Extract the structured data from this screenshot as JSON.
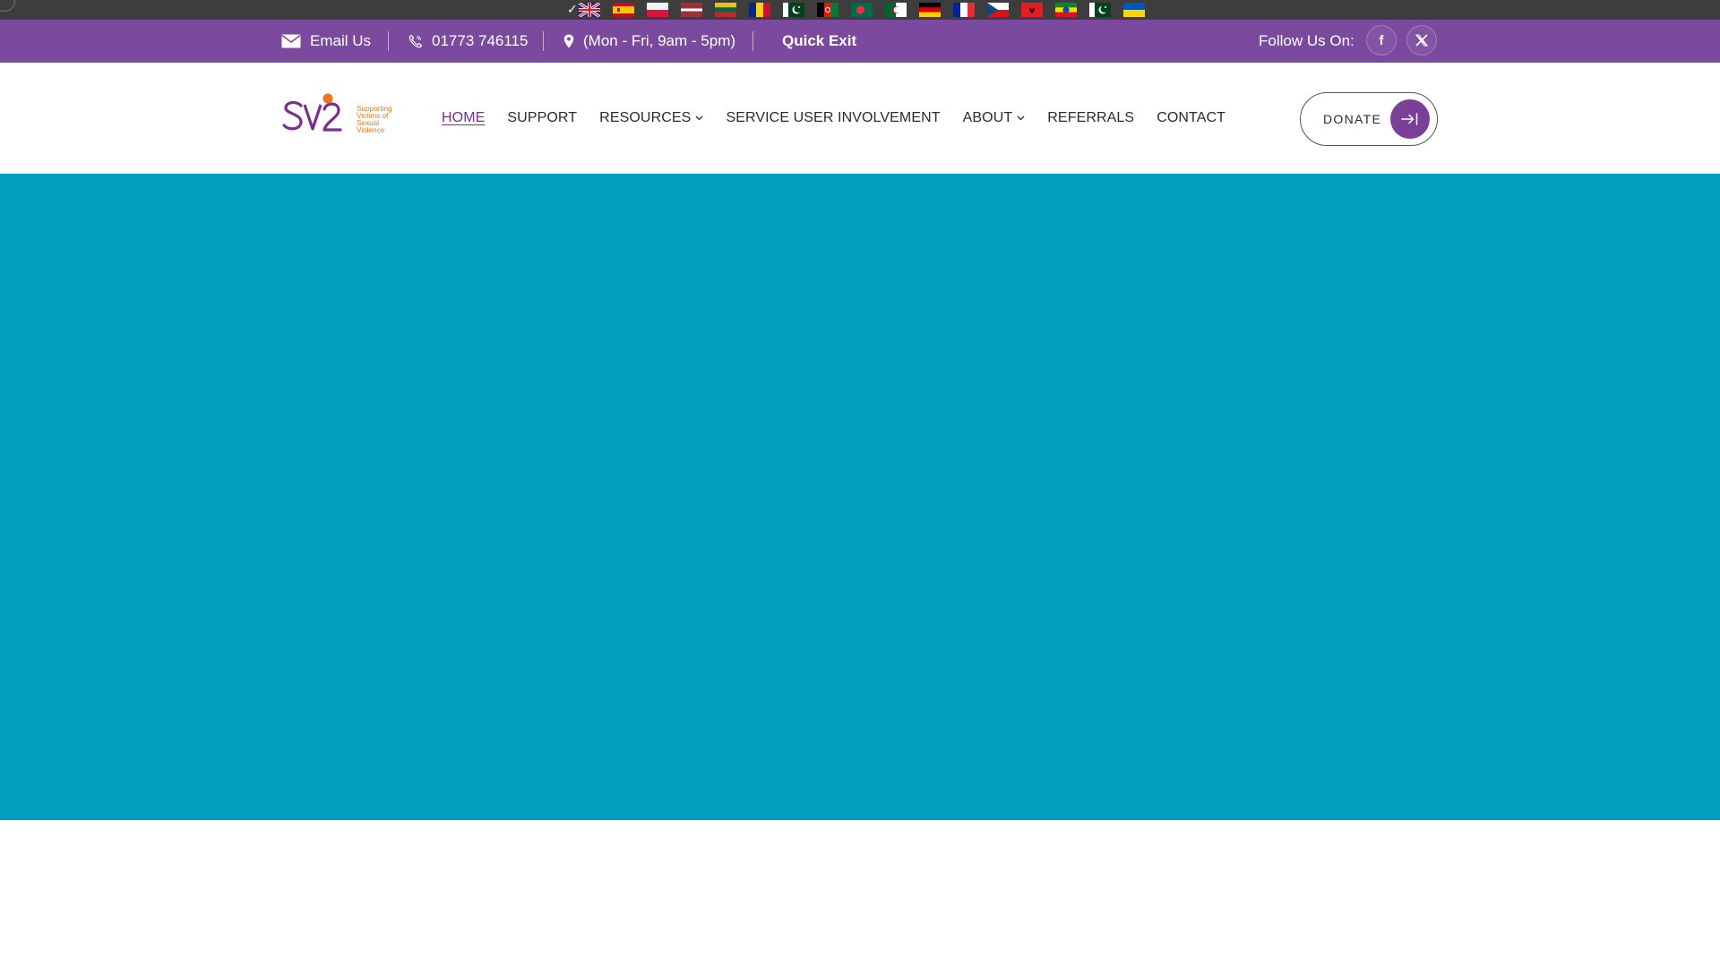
{
  "language_bar": {
    "selected_mark": "✓",
    "flags": [
      {
        "name": "english-uk-flag",
        "country": "United Kingdom"
      },
      {
        "name": "spanish-flag",
        "country": "Spain"
      },
      {
        "name": "polish-flag",
        "country": "Poland"
      },
      {
        "name": "latvian-flag",
        "country": "Latvia"
      },
      {
        "name": "lithuanian-flag",
        "country": "Lithuania"
      },
      {
        "name": "romanian-flag",
        "country": "Romania"
      },
      {
        "name": "urdu-pakistan-flag",
        "country": "Pakistan"
      },
      {
        "name": "afghan-flag",
        "country": "Afghanistan"
      },
      {
        "name": "bangladeshi-flag",
        "country": "Bangladesh"
      },
      {
        "name": "algerian-flag",
        "country": "Algeria"
      },
      {
        "name": "german-flag",
        "country": "Germany"
      },
      {
        "name": "french-flag",
        "country": "France"
      },
      {
        "name": "czech-flag",
        "country": "Czech Republic"
      },
      {
        "name": "albanian-flag",
        "country": "Albania"
      },
      {
        "name": "ethiopian-flag",
        "country": "Ethiopia"
      },
      {
        "name": "pakistani-flag",
        "country": "Pakistan"
      },
      {
        "name": "ukrainian-flag",
        "country": "Ukraine"
      }
    ]
  },
  "topbar": {
    "email_label": "Email Us",
    "phone": "01773 746115",
    "hours": "(Mon - Fri, 9am - 5pm)",
    "quick_exit": "Quick Exit",
    "follow_label": "Follow Us On:",
    "social": [
      {
        "name": "facebook-icon",
        "glyph": "f"
      },
      {
        "name": "x-twitter-icon",
        "glyph": "𝕏"
      }
    ],
    "background_color": "#7b4a9e"
  },
  "logo": {
    "mark": "SV2",
    "tagline": [
      "Supporting",
      "Victims of",
      "Sexual",
      "Violence"
    ],
    "brand_purple": "#7b2e8c",
    "brand_orange": "#e8771e"
  },
  "nav": {
    "items": [
      {
        "label": "HOME",
        "active": true,
        "dropdown": false
      },
      {
        "label": "SUPPORT",
        "active": false,
        "dropdown": false
      },
      {
        "label": "RESOURCES",
        "active": false,
        "dropdown": true
      },
      {
        "label": "SERVICE USER INVOLVEMENT",
        "active": false,
        "dropdown": false
      },
      {
        "label": "ABOUT",
        "active": false,
        "dropdown": true
      },
      {
        "label": "REFERRALS",
        "active": false,
        "dropdown": false
      },
      {
        "label": "CONTACT",
        "active": false,
        "dropdown": false
      }
    ]
  },
  "donate": {
    "label": "DONATE",
    "icon": "arrow-right-to-bar-icon",
    "accent": "#7b3f98"
  },
  "hero": {
    "background_color": "#009fbf"
  }
}
